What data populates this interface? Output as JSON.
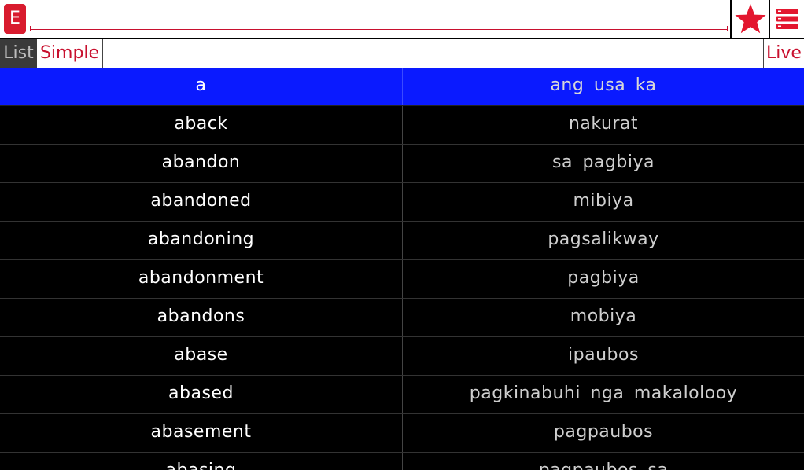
{
  "header": {
    "language_button_label": "E",
    "search_value": "",
    "search_placeholder": "",
    "favorites_icon": "star-icon",
    "menu_icon": "menu-list-icon",
    "accent_color": "#c8102e"
  },
  "tabs": {
    "list_label": "List",
    "simple_label": "Simple",
    "live_label": "Live",
    "active": "List"
  },
  "entries": [
    {
      "word": "a",
      "translation": "ang usa ka",
      "selected": true
    },
    {
      "word": "aback",
      "translation": "nakurat"
    },
    {
      "word": "abandon",
      "translation": "sa pagbiya"
    },
    {
      "word": "abandoned",
      "translation": "mibiya"
    },
    {
      "word": "abandoning",
      "translation": "pagsalikway"
    },
    {
      "word": "abandonment",
      "translation": "pagbiya"
    },
    {
      "word": "abandons",
      "translation": "mobiya"
    },
    {
      "word": "abase",
      "translation": "ipaubos"
    },
    {
      "word": "abased",
      "translation": "pagkinabuhi nga makalolooy"
    },
    {
      "word": "abasement",
      "translation": "pagpaubos"
    },
    {
      "word": "abasing",
      "translation": "pagpaubos sa"
    }
  ],
  "colors": {
    "selected_row": "#0a1aff",
    "background": "#000000",
    "word_text": "#ffffff",
    "translation_text": "#cfcfcf"
  }
}
